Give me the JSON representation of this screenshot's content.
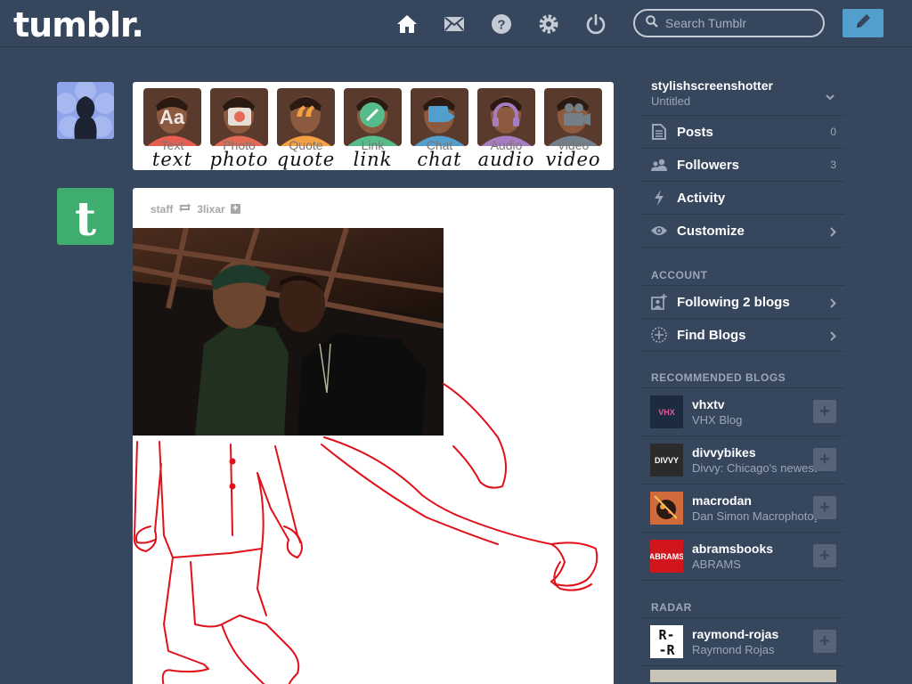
{
  "header": {
    "logo": "tumblr.",
    "search_placeholder": "Search Tumblr",
    "nav": [
      "home-icon",
      "inbox-icon",
      "help-icon",
      "settings-icon",
      "logout-icon"
    ],
    "compose_icon": "pencil-icon"
  },
  "post_types": [
    {
      "label": "Text",
      "script": "text",
      "icon": "Aa",
      "color": "#e65e50"
    },
    {
      "label": "Photo",
      "script": "photo",
      "icon": "camera",
      "color": "#e46a55"
    },
    {
      "label": "Quote",
      "script": "quote",
      "icon": "“",
      "color": "#f4a042"
    },
    {
      "label": "Link",
      "script": "link",
      "icon": "link",
      "color": "#56bc8a"
    },
    {
      "label": "Chat",
      "script": "chat",
      "icon": "chat",
      "color": "#529ecc"
    },
    {
      "label": "Audio",
      "script": "audio",
      "icon": "headphones",
      "color": "#a77dc2"
    },
    {
      "label": "Video",
      "script": "video",
      "icon": "video",
      "color": "#748089"
    }
  ],
  "post": {
    "author": "staff",
    "reblogged_from": "3lixar"
  },
  "sidebar": {
    "blog_name": "stylishscreenshotter",
    "blog_title": "Untitled",
    "items": [
      {
        "label": "Posts",
        "count": "0"
      },
      {
        "label": "Followers",
        "count": "3"
      },
      {
        "label": "Activity",
        "count": ""
      },
      {
        "label": "Customize",
        "count": ""
      }
    ],
    "account_heading": "ACCOUNT",
    "account_items": [
      {
        "label": "Following 2 blogs"
      },
      {
        "label": "Find Blogs"
      }
    ],
    "recommended_heading": "RECOMMENDED BLOGS",
    "recommended": [
      {
        "name": "vhxtv",
        "desc": "VHX Blog",
        "avatar_text": "VHX",
        "bg": "#1c2b3d",
        "fg": "#e05c9a"
      },
      {
        "name": "divvybikes",
        "desc": "Divvy: Chicago's newest",
        "avatar_text": "DIVVY",
        "bg": "#2b2b2b",
        "fg": "#ffffff"
      },
      {
        "name": "macrodan",
        "desc": "Dan Simon Macrophotography",
        "avatar_text": "",
        "bg": "#c8553d",
        "fg": "#ffffff"
      },
      {
        "name": "abramsbooks",
        "desc": "ABRAMS",
        "avatar_text": "ABRAMS",
        "bg": "#d0161c",
        "fg": "#ffffff"
      }
    ],
    "radar_heading": "RADAR",
    "radar": [
      {
        "name": "raymond-rojas",
        "desc": "Raymond Rojas",
        "avatar_text": "R-\n-R",
        "bg": "#ffffff",
        "fg": "#111111"
      }
    ]
  }
}
